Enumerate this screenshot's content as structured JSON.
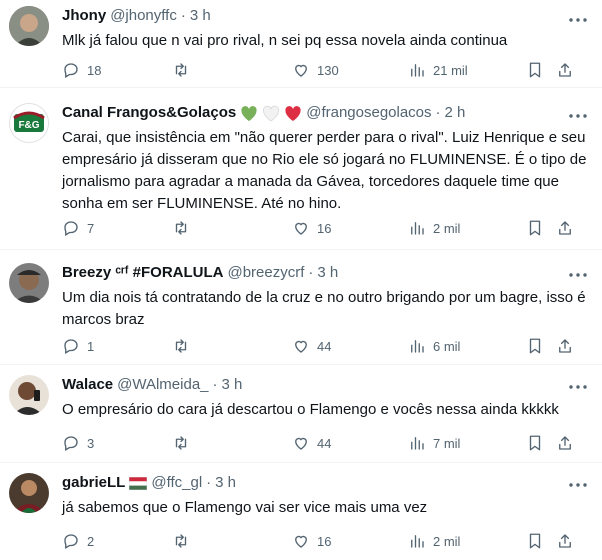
{
  "tweets": [
    {
      "name": "Jhony",
      "handle": "@jhonyffc",
      "time": "3 h",
      "text": "Mlk já falou que n vai pro rival, n sei pq essa novela ainda continua",
      "replies": "18",
      "retweets": "",
      "likes": "130",
      "views": "21 mil"
    },
    {
      "name": "Canal Frangos&Golaços",
      "handle": "@frangosegolacos",
      "time": "2 h",
      "text": "Carai, que insistência em \"não querer perder para o rival\". Luiz Henrique e seu empresário já disseram que no Rio ele só jogará no FLUMINENSE. É o tipo de jornalismo para agradar a manada da Gávea, torcedores daquele time que sonha em ser FLUMINENSE. Até no hino.",
      "replies": "7",
      "retweets": "",
      "likes": "16",
      "views": "2 mil",
      "avatar_text": "F&G"
    },
    {
      "name": "Breezy ᶜʳᶠ #FORALULA",
      "handle": "@breezycrf",
      "time": "3 h",
      "text": "Um dia nois tá contratando de la cruz e no outro brigando por um bagre, isso é marcos braz",
      "replies": "1",
      "retweets": "",
      "likes": "44",
      "views": "6 mil"
    },
    {
      "name": "Walace",
      "handle": "@WAlmeida_",
      "time": "3 h",
      "text": "O empresário do cara já descartou o Flamengo e vocês nessa ainda kkkkk",
      "replies": "3",
      "retweets": "",
      "likes": "44",
      "views": "7 mil"
    },
    {
      "name": "gabrieLL",
      "handle": "@ffc_gl",
      "time": "3 h",
      "text": "já sabemos que o Flamengo vai ser vice mais uma vez",
      "replies": "2",
      "retweets": "",
      "likes": "16",
      "views": "2 mil"
    }
  ],
  "colors": {
    "text": "#0f1419",
    "secondary": "#536471",
    "divider": "#eff3f4",
    "fluminense_green": "#1a7a3c",
    "fluminense_red": "#9c1c2a"
  }
}
